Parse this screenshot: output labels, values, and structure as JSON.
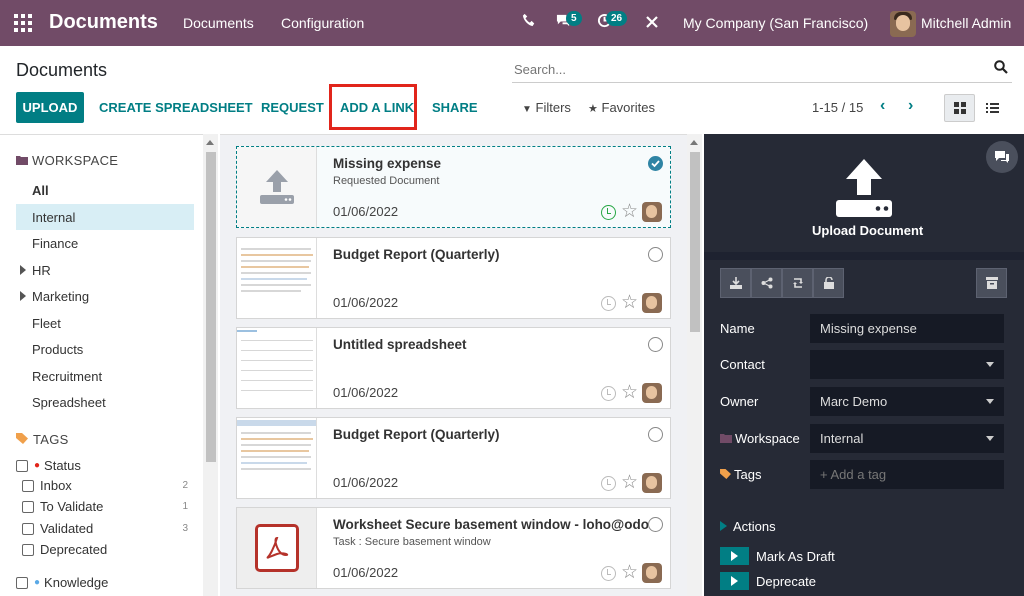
{
  "navbar": {
    "app_title": "Documents",
    "menu": [
      "Documents",
      "Configuration"
    ],
    "messages_count": "5",
    "activities_count": "26",
    "company": "My Company (San Francisco)",
    "user": "Mitchell Admin"
  },
  "control_panel": {
    "title": "Documents",
    "search_placeholder": "Search...",
    "buttons": {
      "upload": "UPLOAD",
      "create_spreadsheet": "CREATE SPREADSHEET",
      "request": "REQUEST",
      "add_link": "ADD A LINK",
      "share": "SHARE"
    },
    "filters": "Filters",
    "favorites": "Favorites",
    "pager": "1-15 / 15"
  },
  "sidebar": {
    "workspace_header": "WORKSPACE",
    "workspaces": [
      "All",
      "Internal",
      "Finance",
      "HR",
      "Marketing",
      "Fleet",
      "Products",
      "Recruitment",
      "Spreadsheet"
    ],
    "selected_workspace": "Internal",
    "tags_header": "TAGS",
    "status_group": "Status",
    "tags": [
      {
        "label": "Inbox",
        "count": "2"
      },
      {
        "label": "To Validate",
        "count": "1"
      },
      {
        "label": "Validated",
        "count": "3"
      },
      {
        "label": "Deprecated",
        "count": ""
      }
    ],
    "knowledge_group": "Knowledge"
  },
  "documents": [
    {
      "name": "Missing expense",
      "subtitle": "Requested Document",
      "date": "01/06/2022",
      "selected": true,
      "thumb": "upload"
    },
    {
      "name": "Budget Report (Quarterly)",
      "subtitle": "",
      "date": "01/06/2022",
      "selected": false,
      "thumb": "sheet"
    },
    {
      "name": "Untitled spreadsheet",
      "subtitle": "",
      "date": "01/06/2022",
      "selected": false,
      "thumb": "blank-sheet"
    },
    {
      "name": "Budget Report (Quarterly)",
      "subtitle": "",
      "date": "01/06/2022",
      "selected": false,
      "thumb": "sheet"
    },
    {
      "name": "Worksheet Secure basement window - loho@odoo.c...",
      "subtitle": "Task : Secure basement window",
      "date": "01/06/2022",
      "selected": false,
      "thumb": "pdf"
    }
  ],
  "details": {
    "upload_label": "Upload Document",
    "fields": {
      "name_label": "Name",
      "name_value": "Missing expense",
      "contact_label": "Contact",
      "contact_value": "",
      "owner_label": "Owner",
      "owner_value": "Marc Demo",
      "workspace_label": "Workspace",
      "workspace_value": "Internal",
      "tags_label": "Tags",
      "tags_placeholder": "+ Add a tag"
    },
    "actions_header": "Actions",
    "actions": [
      "Mark As Draft",
      "Deprecate"
    ]
  },
  "colors": {
    "navbar": "#714B67",
    "accent": "#017e84",
    "panel": "#262a36",
    "selected_row": "#d8eef5",
    "highlight_box": "#e1251b"
  }
}
